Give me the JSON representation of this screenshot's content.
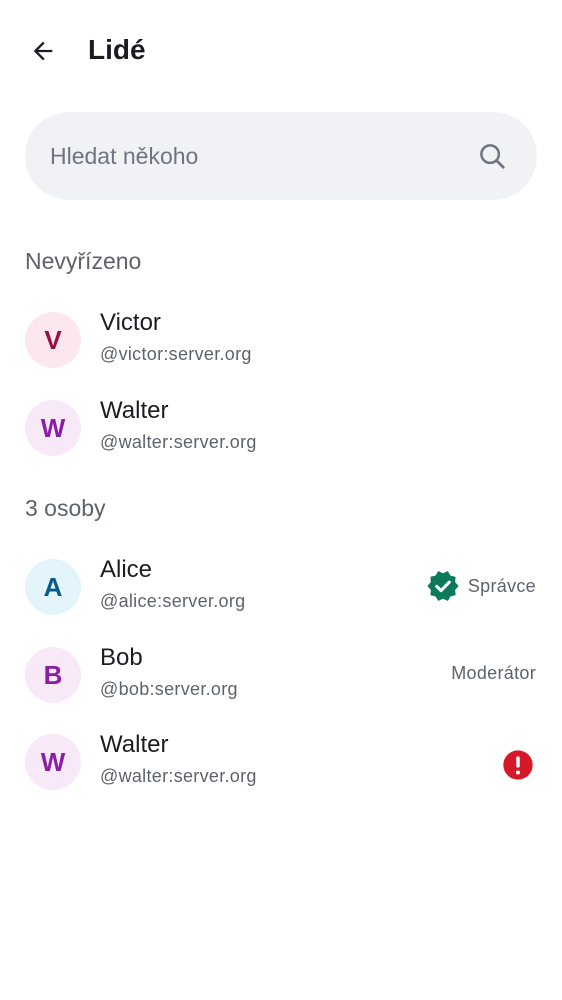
{
  "header": {
    "title": "Lidé"
  },
  "search": {
    "placeholder": "Hledat někoho"
  },
  "pending": {
    "title": "Nevyřízeno",
    "members": [
      {
        "initial": "V",
        "name": "Victor",
        "handle": "@victor:server.org",
        "avatar_bg": "#fde7ee",
        "avatar_fg": "#9a0e48"
      },
      {
        "initial": "W",
        "name": "Walter",
        "handle": "@walter:server.org",
        "avatar_bg": "#f7e9f8",
        "avatar_fg": "#8a1fa4"
      }
    ]
  },
  "joined": {
    "title": "3 osoby",
    "members": [
      {
        "initial": "A",
        "name": "Alice",
        "handle": "@alice:server.org",
        "role": "Správce",
        "avatar_bg": "#e3f4fa",
        "avatar_fg": "#0a5a8a"
      },
      {
        "initial": "B",
        "name": "Bob",
        "handle": "@bob:server.org",
        "role": "Moderátor",
        "avatar_bg": "#f7e9f8",
        "avatar_fg": "#8a1fa4"
      },
      {
        "initial": "W",
        "name": "Walter",
        "handle": "@walter:server.org",
        "avatar_bg": "#f7e9f8",
        "avatar_fg": "#8a1fa4"
      }
    ]
  },
  "colors": {
    "verified": "#0b7a5a",
    "error": "#d51928"
  },
  "icons": {
    "back": "arrow-back-icon",
    "search": "search-icon",
    "verified": "verified-badge-icon",
    "error": "error-icon"
  }
}
